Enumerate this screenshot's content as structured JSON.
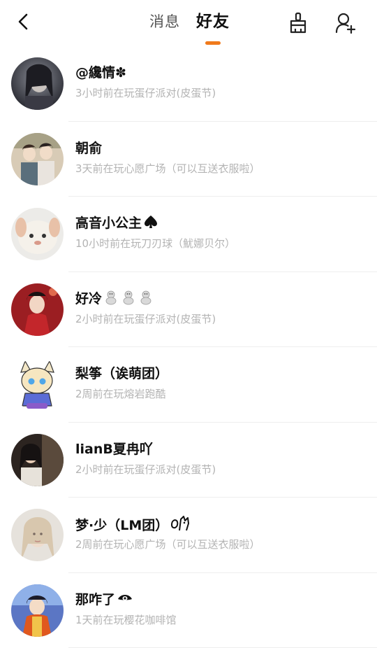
{
  "header": {
    "tabs": [
      {
        "label": "消息",
        "active": false
      },
      {
        "label": "好友",
        "active": true
      }
    ],
    "accent_color": "#f07a1c",
    "icons": [
      "back-arrow-icon",
      "broom-icon",
      "add-user-icon"
    ]
  },
  "friends": [
    {
      "name": "@纔情✽",
      "status": "3小时前在玩蛋仔派对(皮蛋节)"
    },
    {
      "name": "朝俞",
      "status": "3天前在玩心愿广场（可以互送衣服啦）"
    },
    {
      "name": "高音小公主",
      "name_icon": "spade-icon",
      "status": "10小时前在玩刀刃球（魷娜贝尔）"
    },
    {
      "name": "好冷",
      "name_icon": "snowman-icons",
      "status": "2小时前在玩蛋仔派对(皮蛋节)"
    },
    {
      "name": "梨筝（诶萌团）",
      "status": "2周前在玩熔岩跑酷"
    },
    {
      "name": "lianB夏冉吖",
      "status": "2小时前在玩蛋仔派对(皮蛋节)"
    },
    {
      "name": "梦·少（LM团）",
      "name_icon": "cat-doodle-icon",
      "status": "2周前在玩心愿广场（可以互送衣服啦）"
    },
    {
      "name": "那咋了",
      "name_icon": "eye-icon",
      "status": "1天前在玩樱花咖啡馆"
    }
  ]
}
